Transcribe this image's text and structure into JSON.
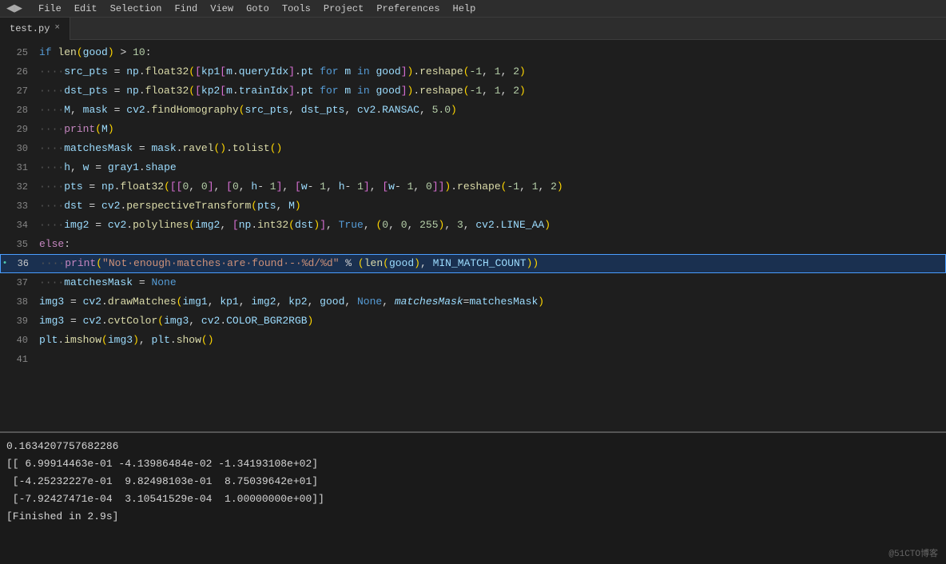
{
  "menubar": {
    "items": [
      "File",
      "Edit",
      "Selection",
      "Find",
      "View",
      "Goto",
      "Tools",
      "Project",
      "Preferences",
      "Help"
    ]
  },
  "tab": {
    "filename": "test.py",
    "close_label": "×"
  },
  "sidebar_toggle": "◀▶",
  "code": {
    "lines": [
      {
        "num": 25,
        "content": "if·len(good)·>·10:",
        "indicator": ""
      },
      {
        "num": 26,
        "content": "····src_pts·=·np.float32([kp1[m.queryIdx].pt·for·m·in·good]).reshape(-1,·1,·2)",
        "indicator": ""
      },
      {
        "num": 27,
        "content": "····dst_pts·=·np.float32([kp2[m.trainIdx].pt·for·m·in·good]).reshape(-1,·1,·2)",
        "indicator": ""
      },
      {
        "num": 28,
        "content": "····M,·mask·=·cv2.findHomography(src_pts,·dst_pts,·cv2.RANSAC,·5.0)",
        "indicator": ""
      },
      {
        "num": 29,
        "content": "····print(M)",
        "indicator": ""
      },
      {
        "num": 30,
        "content": "····matchesMask·=·mask.ravel().tolist()",
        "indicator": ""
      },
      {
        "num": 31,
        "content": "····h,·w·=·gray1.shape",
        "indicator": ""
      },
      {
        "num": 32,
        "content": "····pts·=·np.float32([[0,·0],·[0,·h-·1],·[w-·1,·h-·1],·[w-·1,·0]]).reshape(-1,·1,·2)",
        "indicator": ""
      },
      {
        "num": 33,
        "content": "····dst·=·cv2.perspectiveTransform(pts,·M)",
        "indicator": ""
      },
      {
        "num": 34,
        "content": "····img2·=·cv2.polylines(img2,·[np.int32(dst)],·True,·(0,·0,·255),·3,·cv2.LINE_AA)",
        "indicator": ""
      },
      {
        "num": 35,
        "content": "else:",
        "indicator": ""
      },
      {
        "num": 36,
        "content": "····print(\"Not·enough·matches·are·found·-·%d/%d\"·%·(len(good),·MIN_MATCH_COUNT))",
        "indicator": "•",
        "active": true
      },
      {
        "num": 37,
        "content": "····matchesMask·=·None",
        "indicator": ""
      },
      {
        "num": 38,
        "content": "img3·=·cv2.drawMatches(img1,·kp1,·img2,·kp2,·good,·None,·matchesMask=matchesMask)",
        "indicator": ""
      },
      {
        "num": 39,
        "content": "img3·=·cv2.cvtColor(img3,·cv2.COLOR_BGR2RGB)",
        "indicator": ""
      },
      {
        "num": 40,
        "content": "plt.imshow(img3),·plt.show()",
        "indicator": ""
      },
      {
        "num": 41,
        "content": "",
        "indicator": ""
      }
    ]
  },
  "output": {
    "lines": [
      "0.1634207757682286",
      "[[ 6.99914463e-01 -4.13986484e-02 -1.34193108e+02]",
      " [-4.25232227e-01  9.82498103e-01  8.75039642e+01]",
      " [-7.92427471e-04  3.10541529e-04  1.00000000e+00]]",
      "[Finished in 2.9s]"
    ],
    "watermark": "@51CTO博客"
  }
}
